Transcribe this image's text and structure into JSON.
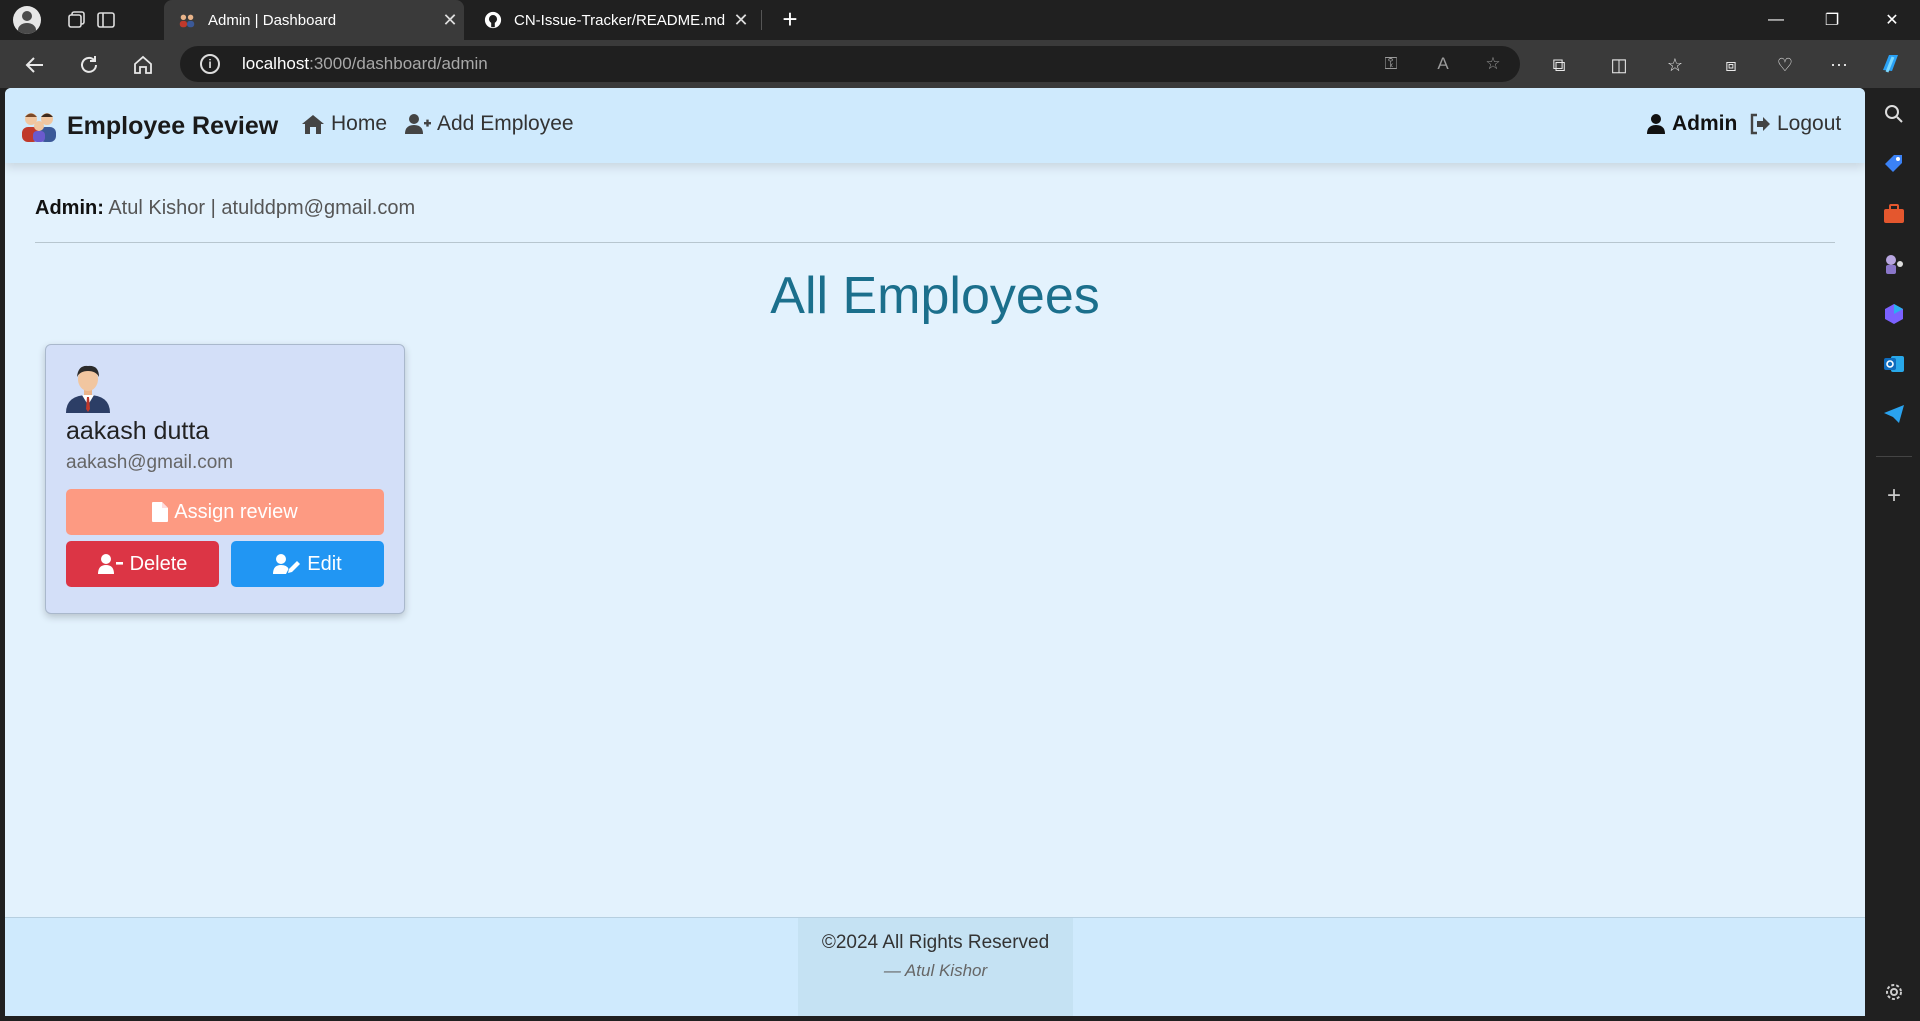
{
  "browser": {
    "tabs": [
      {
        "title": "Admin | Dashboard",
        "active": true
      },
      {
        "title": "CN-Issue-Tracker/README.md at",
        "active": false
      }
    ],
    "url_host": "localhost",
    "url_path": ":3000/dashboard/admin"
  },
  "navbar": {
    "brand": "Employee Review",
    "home": "Home",
    "add_employee": "Add Employee",
    "admin": "Admin",
    "logout": "Logout"
  },
  "admin_info": {
    "label": "Admin:",
    "name": "Atul Kishor",
    "separator": "|",
    "email": "atulddpm@gmail.com"
  },
  "page_title": "All Employees",
  "employees": [
    {
      "name": "aakash dutta",
      "email": "aakash@gmail.com",
      "assign_label": "Assign review",
      "delete_label": "Delete",
      "edit_label": "Edit"
    }
  ],
  "footer": {
    "copyright": "©2024 All Rights Reserved",
    "author": "— Atul Kishor"
  },
  "colors": {
    "page_bg": "#e3f2fd",
    "navbar_bg": "#cfeafd",
    "title": "#1b6f8c",
    "assign": "#fd9a82",
    "delete": "#dc3545",
    "edit": "#2196f3"
  }
}
